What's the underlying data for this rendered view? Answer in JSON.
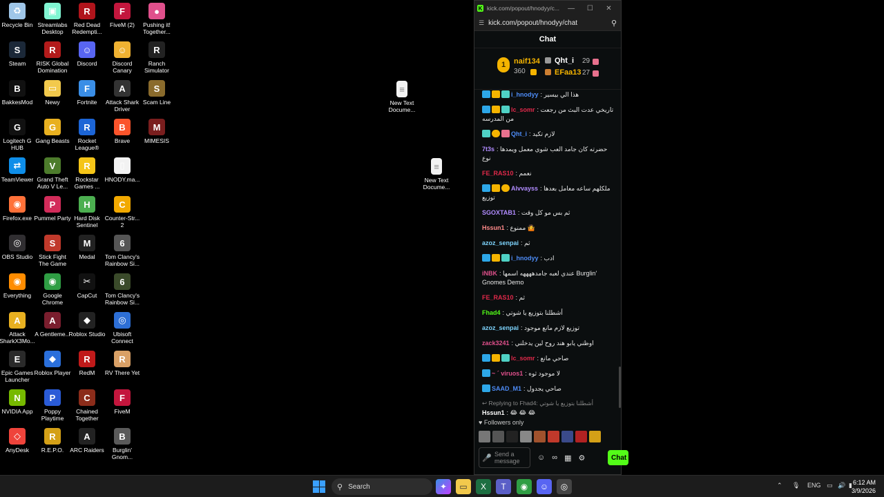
{
  "desktop": {
    "icons": [
      {
        "label": "Recycle Bin",
        "icon": "recycle-bin-icon",
        "color": "#9fc6e8",
        "glyph": "♻"
      },
      {
        "label": "Streamlabs Desktop",
        "icon": "streamlabs-icon",
        "color": "#80f5d2",
        "glyph": "▣"
      },
      {
        "label": "Red Dead Redempti...",
        "icon": "red-dead-icon",
        "color": "#b0141b",
        "glyph": "R"
      },
      {
        "label": "FiveM (2)",
        "icon": "fivem-icon",
        "color": "#c3163d",
        "glyph": "F"
      },
      {
        "label": "Pushing it! Together...",
        "icon": "pushing-it-icon",
        "color": "#e0508c",
        "glyph": "●"
      },
      {
        "label": "Steam",
        "icon": "steam-icon",
        "color": "#1b2838",
        "glyph": "S"
      },
      {
        "label": "RISK Global Domination",
        "icon": "risk-icon",
        "color": "#b31b1b",
        "glyph": "R"
      },
      {
        "label": "Discord",
        "icon": "discord-icon",
        "color": "#5865f2",
        "glyph": "☺"
      },
      {
        "label": "Discord Canary",
        "icon": "discord-canary-icon",
        "color": "#f0b232",
        "glyph": "☺"
      },
      {
        "label": "Ranch Simulator",
        "icon": "ranch-simulator-icon",
        "color": "#222222",
        "glyph": "R"
      },
      {
        "label": "BakkesMod",
        "icon": "bakkesmod-icon",
        "color": "#111111",
        "glyph": "B"
      },
      {
        "label": "Newy",
        "icon": "folder-icon",
        "color": "#f2c94c",
        "glyph": "▭"
      },
      {
        "label": "Fortnite",
        "icon": "fortnite-icon",
        "color": "#3a8ee6",
        "glyph": "F"
      },
      {
        "label": "Attack Shark Driver",
        "icon": "attack-shark-driver-icon",
        "color": "#333333",
        "glyph": "A"
      },
      {
        "label": "Scam Line",
        "icon": "scam-line-icon",
        "color": "#8a6b2c",
        "glyph": "S"
      },
      {
        "label": "Logitech G HUB",
        "icon": "logitech-icon",
        "color": "#111111",
        "glyph": "G"
      },
      {
        "label": "Gang Beasts",
        "icon": "gang-beasts-icon",
        "color": "#e8b020",
        "glyph": "G"
      },
      {
        "label": "Rocket League®",
        "icon": "rocket-league-icon",
        "color": "#1c65d6",
        "glyph": "R"
      },
      {
        "label": "Brave",
        "icon": "brave-icon",
        "color": "#fb542b",
        "glyph": "B"
      },
      {
        "label": "MIMESIS",
        "icon": "mimesis-icon",
        "color": "#7a1e1e",
        "glyph": "M"
      },
      {
        "label": "TeamViewer",
        "icon": "teamviewer-icon",
        "color": "#0e8ee9",
        "glyph": "⇄"
      },
      {
        "label": "Grand Theft Auto V Le...",
        "icon": "gta-v-icon",
        "color": "#4d7c2c",
        "glyph": "V"
      },
      {
        "label": "Rockstar Games ...",
        "icon": "rockstar-icon",
        "color": "#f5c518",
        "glyph": "R"
      },
      {
        "label": "HNODY.ma...",
        "icon": "file-icon",
        "color": "#f2f2f2",
        "glyph": "▯"
      },
      {
        "label": "",
        "icon": "blank",
        "color": "",
        "glyph": ""
      },
      {
        "label": "Firefox.exe",
        "icon": "firefox-icon",
        "color": "#ff7139",
        "glyph": "◉"
      },
      {
        "label": "Pummel Party",
        "icon": "pummel-party-icon",
        "color": "#d22c5a",
        "glyph": "P"
      },
      {
        "label": "Hard Disk Sentinel",
        "icon": "hard-disk-sentinel-icon",
        "color": "#4caf50",
        "glyph": "H"
      },
      {
        "label": "Counter-Str... 2",
        "icon": "counter-strike-icon",
        "color": "#f2a900",
        "glyph": "C"
      },
      {
        "label": "",
        "icon": "blank",
        "color": "",
        "glyph": ""
      },
      {
        "label": "OBS Studio",
        "icon": "obs-icon",
        "color": "#302e31",
        "glyph": "◎"
      },
      {
        "label": "Stick Fight The Game",
        "icon": "stick-fight-icon",
        "color": "#c0392b",
        "glyph": "S"
      },
      {
        "label": "Medal",
        "icon": "medal-icon",
        "color": "#222222",
        "glyph": "M"
      },
      {
        "label": "Tom Clancy's Rainbow Si...",
        "icon": "rainbow-six-icon",
        "color": "#555555",
        "glyph": "6"
      },
      {
        "label": "",
        "icon": "blank",
        "color": "",
        "glyph": ""
      },
      {
        "label": "Everything",
        "icon": "everything-icon",
        "color": "#ff8c00",
        "glyph": "◉"
      },
      {
        "label": "Google Chrome",
        "icon": "chrome-icon",
        "color": "#2f9e44",
        "glyph": "◉"
      },
      {
        "label": "CapCut",
        "icon": "capcut-icon",
        "color": "#111111",
        "glyph": "✂"
      },
      {
        "label": "Tom Clancy's Rainbow Si...",
        "icon": "rainbow-six-icon",
        "color": "#3a4a2a",
        "glyph": "6"
      },
      {
        "label": "",
        "icon": "blank",
        "color": "",
        "glyph": ""
      },
      {
        "label": "Attack SharkX3Mo...",
        "icon": "attack-shark-mouse-icon",
        "color": "#e8b020",
        "glyph": "A"
      },
      {
        "label": "A Gentleme...",
        "icon": "gentlemen-icon",
        "color": "#7a1e2e",
        "glyph": "A"
      },
      {
        "label": "Roblox Studio",
        "icon": "roblox-studio-icon",
        "color": "#222222",
        "glyph": "◆"
      },
      {
        "label": "Ubisoft Connect",
        "icon": "ubisoft-icon",
        "color": "#2d6fd6",
        "glyph": "◎"
      },
      {
        "label": "",
        "icon": "blank",
        "color": "",
        "glyph": ""
      },
      {
        "label": "Epic Games Launcher",
        "icon": "epic-games-icon",
        "color": "#2a2a2a",
        "glyph": "E"
      },
      {
        "label": "Roblox Player",
        "icon": "roblox-icon",
        "color": "#2a6fdb",
        "glyph": "◆"
      },
      {
        "label": "RedM",
        "icon": "redm-icon",
        "color": "#c01a1a",
        "glyph": "R"
      },
      {
        "label": "RV There Yet",
        "icon": "rv-there-yet-icon",
        "color": "#d9a066",
        "glyph": "R"
      },
      {
        "label": "",
        "icon": "blank",
        "color": "",
        "glyph": ""
      },
      {
        "label": "NVIDIA App",
        "icon": "nvidia-icon",
        "color": "#76b900",
        "glyph": "N"
      },
      {
        "label": "Poppy Playtime",
        "icon": "poppy-playtime-icon",
        "color": "#2a5bd7",
        "glyph": "P"
      },
      {
        "label": "Chained Together",
        "icon": "chained-together-icon",
        "color": "#8b2c1a",
        "glyph": "C"
      },
      {
        "label": "FiveM",
        "icon": "fivem-icon",
        "color": "#c3163d",
        "glyph": "F"
      },
      {
        "label": "",
        "icon": "blank",
        "color": "",
        "glyph": ""
      },
      {
        "label": "AnyDesk",
        "icon": "anydesk-icon",
        "color": "#ef443b",
        "glyph": "◇"
      },
      {
        "label": "R.E.P.O.",
        "icon": "repo-icon",
        "color": "#d4a017",
        "glyph": "R"
      },
      {
        "label": "ARC Raiders",
        "icon": "arc-raiders-icon",
        "color": "#222222",
        "glyph": "A"
      },
      {
        "label": "Burglin' Gnom...",
        "icon": "burglin-gnomes-icon",
        "color": "#5a5a5a",
        "glyph": "B"
      },
      {
        "label": "",
        "icon": "blank",
        "color": "",
        "glyph": ""
      }
    ],
    "files": [
      {
        "label": "New Text Docume..."
      },
      {
        "label": "New Text Docume..."
      }
    ]
  },
  "chat_window": {
    "tab_title": "kick.com/popout/hnodyy/c...",
    "url": "kick.com/popout/hnodyy/chat",
    "header": "Chat",
    "leaderboard": {
      "first": {
        "name": "naif134",
        "value": "360",
        "color": "#f5b400"
      },
      "second": {
        "name": "Qht_i",
        "value": "29",
        "color": "#ffffff"
      },
      "third": {
        "name": "EFaa13",
        "value": "27",
        "color": "#f5b400"
      },
      "rank": "1"
    },
    "messages": [
      {
        "badges": [
          "mod",
          "sub",
          "vip"
        ],
        "user": "i_hnodyy",
        "color": "#4d8bf5",
        "text": "هذا الي بيسير"
      },
      {
        "badges": [
          "mod",
          "sub",
          "vip"
        ],
        "user": "lc_somr",
        "color": "#e0294a",
        "text": "تاريخي عدت البث من رجعت من المدرسه"
      },
      {
        "badges": [
          "vip",
          "lvl",
          "gift"
        ],
        "user": "Qht_i",
        "color": "#4d8bf5",
        "text": "لازم تكيد"
      },
      {
        "badges": [],
        "user": "7t3s",
        "color": "#b18cff",
        "text": "حضرته كان جامد العب شوي معمل ويمدها نوع"
      },
      {
        "badges": [],
        "user": "FE_RAS10",
        "color": "#e0294a",
        "text": "نعمم"
      },
      {
        "badges": [
          "mod",
          "sub",
          "lvl"
        ],
        "user": "Alvvayss",
        "color": "#b18cff",
        "text": "ملكلهم ساعه معامل بعدها توزيع"
      },
      {
        "badges": [],
        "user": "SGOXTAB1",
        "color": "#b18cff",
        "text": "ثم بس مو كل وقت"
      },
      {
        "badges": [],
        "user": "Hssun1",
        "color": "#ff8a8a",
        "text": "ممنوع 🤷"
      },
      {
        "badges": [],
        "user": "azoz_senpai",
        "color": "#7dd3fc",
        "text": "ثم"
      },
      {
        "badges": [
          "mod",
          "sub",
          "vip"
        ],
        "user": "i_hnodyy",
        "color": "#4d8bf5",
        "text": "ادب"
      },
      {
        "badges": [],
        "user": "iNBK",
        "color": "#e0508c",
        "text": "عندي لعبه جامدههههه اسمها Burglin' Gnomes Demo"
      },
      {
        "badges": [],
        "user": "FE_RAS10",
        "color": "#e0294a",
        "text": "ثم"
      },
      {
        "badges": [],
        "user": "Fhad4",
        "color": "#53fc18",
        "text": "أشطلنا بتوزيع يا شوتي"
      },
      {
        "badges": [],
        "user": "azoz_senpai",
        "color": "#7dd3fc",
        "text": "توزيع لازم مانع موجود"
      },
      {
        "badges": [],
        "user": "zack3241",
        "color": "#e0508c",
        "text": "اوظني يابو هند روح لين يدخلني"
      },
      {
        "badges": [
          "mod",
          "sub",
          "vip"
        ],
        "user": "lc_somr",
        "color": "#e0294a",
        "text": "صاحي مانع"
      },
      {
        "badges": [
          "mod"
        ],
        "user": "~ ´ viruos1",
        "color": "#e0508c",
        "text": "لا موجود ثوه"
      },
      {
        "badges": [
          "mod"
        ],
        "user": "SAAD_M1",
        "color": "#4d8bf5",
        "text": "صاحي يجدول"
      }
    ],
    "reply": {
      "label": "Replying to Fhad4:",
      "quoted": "أشطلنا بتوزيع يا شوتي",
      "user": "Hssun1",
      "color": "#ffffff",
      "text": "😂 😂 😂"
    },
    "followers_only": "Followers only",
    "input_placeholder": "Send a message",
    "chat_button": "Chat"
  },
  "taskbar": {
    "search_label": "Search",
    "language": "ENG",
    "time": "6:12 AM",
    "date": "3/9/2026"
  }
}
